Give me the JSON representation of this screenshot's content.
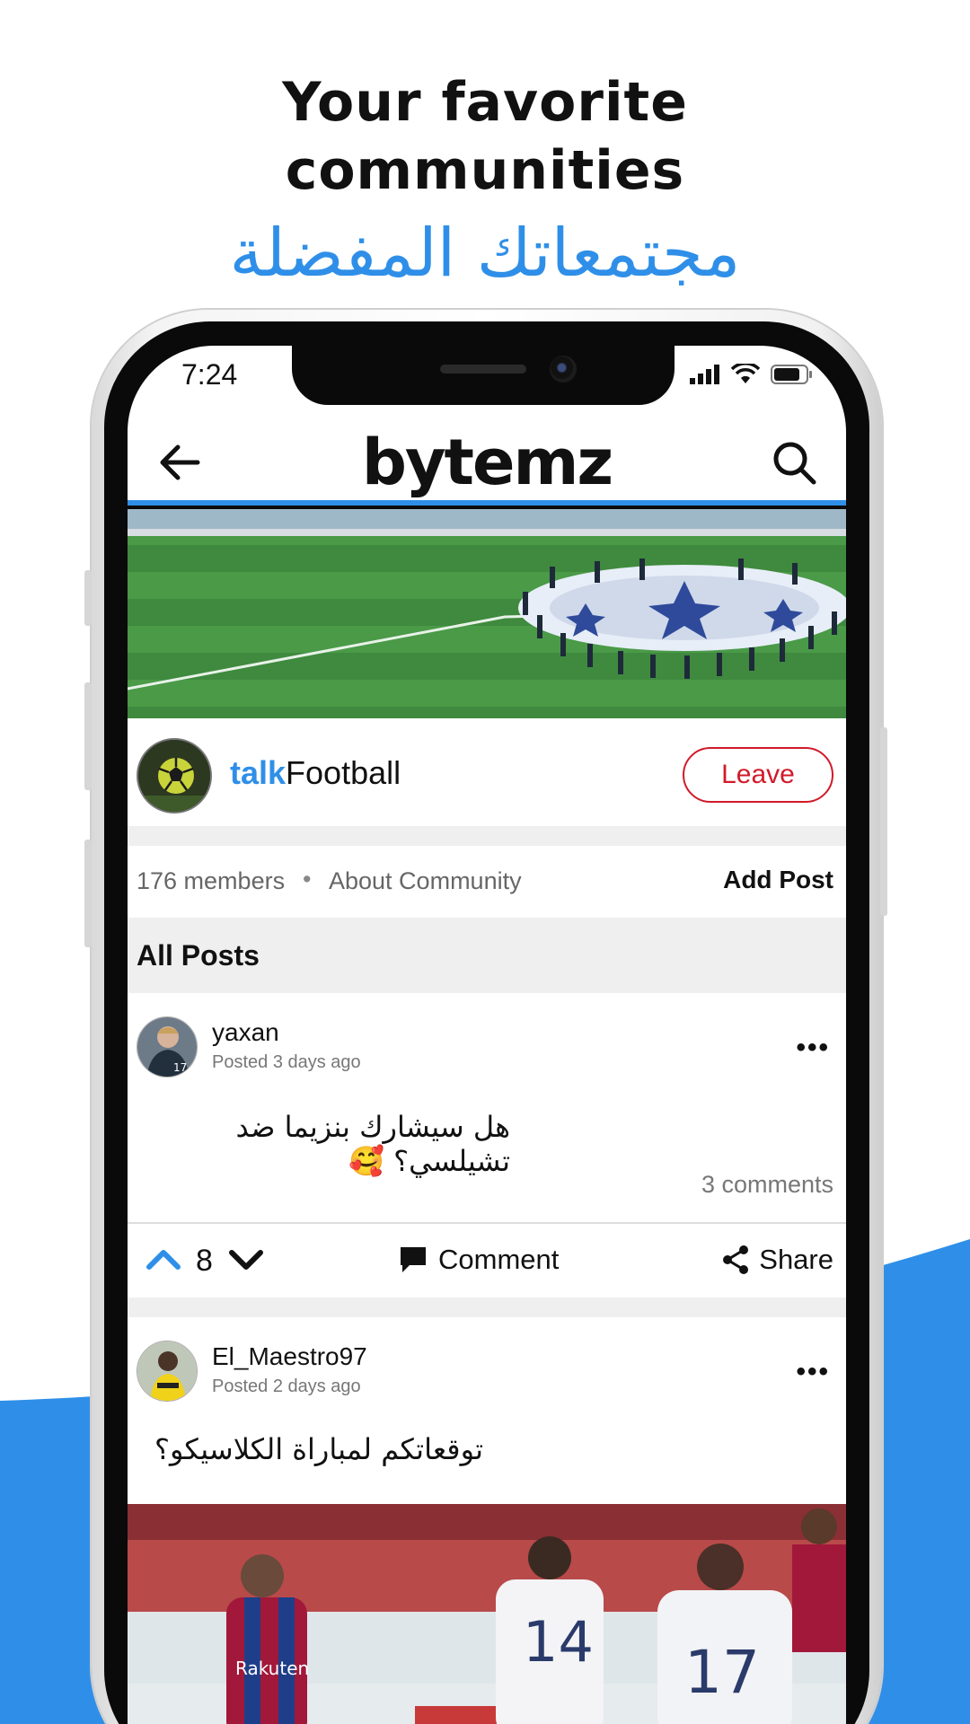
{
  "headline": {
    "english_line1": "Your favorite",
    "english_line2": "communities",
    "arabic": "مجتمعاتك المفضلة"
  },
  "colors": {
    "accent": "#2f8fe8",
    "leave": "#d11a2a",
    "text": "#111111",
    "muted": "#777777",
    "divider": "#efefef"
  },
  "status_bar": {
    "time": "7:24",
    "icons": [
      "signal-icon",
      "wifi-icon",
      "battery-icon"
    ]
  },
  "app_bar": {
    "logo": "bytemz",
    "back_icon": "arrow-left-icon",
    "search_icon": "search-icon"
  },
  "community": {
    "name_prefix": "talk",
    "name_suffix": "Football",
    "leave_label": "Leave",
    "members": "176 members",
    "separator": "•",
    "about": "About Community",
    "add_post": "Add Post",
    "section_title": "All Posts"
  },
  "posts": [
    {
      "author": "yaxan",
      "posted": "Posted 3 days ago",
      "text": "هل سيشارك بنزيما ضد تشيلسي؟ 🥰",
      "comments": "3 comments",
      "votes": "8",
      "comment_label": "Comment",
      "share_label": "Share"
    },
    {
      "author": "El_Maestro97",
      "posted": "Posted 2 days ago",
      "text": "توقعاتكم لمباراة الكلاسيكو؟"
    }
  ]
}
